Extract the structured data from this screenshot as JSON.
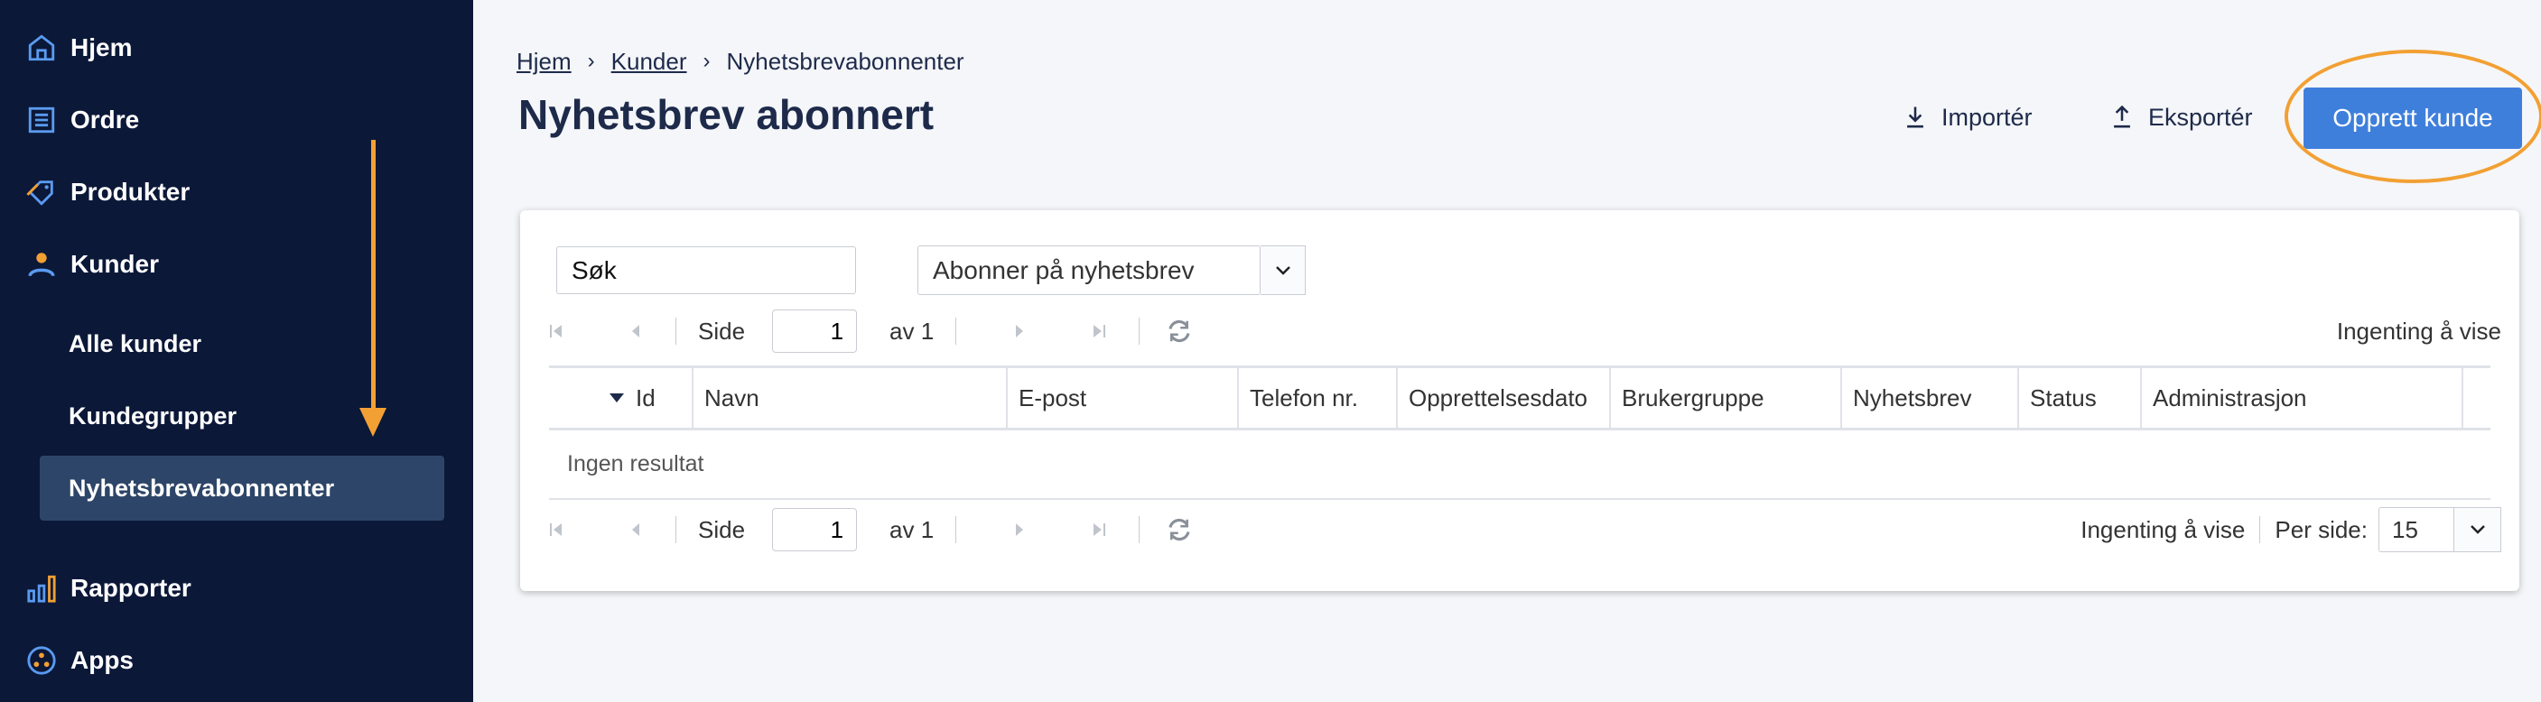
{
  "sidebar": {
    "items": [
      {
        "label": "Hjem",
        "icon": "home-icon"
      },
      {
        "label": "Ordre",
        "icon": "list-icon"
      },
      {
        "label": "Produkter",
        "icon": "tag-icon"
      },
      {
        "label": "Kunder",
        "icon": "person-icon"
      },
      {
        "label": "Rapporter",
        "icon": "bar-chart-icon"
      },
      {
        "label": "Apps",
        "icon": "apps-icon"
      }
    ],
    "sub_items": [
      {
        "label": "Alle kunder"
      },
      {
        "label": "Kundegrupper"
      },
      {
        "label": "Nyhetsbrevabonnenter",
        "active": true
      }
    ]
  },
  "breadcrumb": {
    "home": "Hjem",
    "customers": "Kunder",
    "current": "Nyhetsbrevabonnenter"
  },
  "header": {
    "title": "Nyhetsbrev abonnert",
    "import_label": "Importér",
    "export_label": "Eksportér",
    "create_label": "Opprett kunde"
  },
  "filters": {
    "search_value": "Søk",
    "select_value": "Abonner på nyhetsbrev"
  },
  "pager": {
    "side_label": "Side",
    "page_value": "1",
    "of_label": "av 1",
    "empty_text": "Ingenting å vise",
    "per_page_label": "Per side:",
    "per_page_value": "15"
  },
  "table": {
    "columns": [
      "Id",
      "Navn",
      "E-post",
      "Telefon nr.",
      "Opprettelsesdato",
      "Brukergruppe",
      "Nyhetsbrev",
      "Status",
      "Administrasjon"
    ],
    "empty_message": "Ingen resultat"
  },
  "colors": {
    "sidebar_bg": "#0b1838",
    "accent": "#3f7fdc",
    "highlight": "#f2a033"
  }
}
